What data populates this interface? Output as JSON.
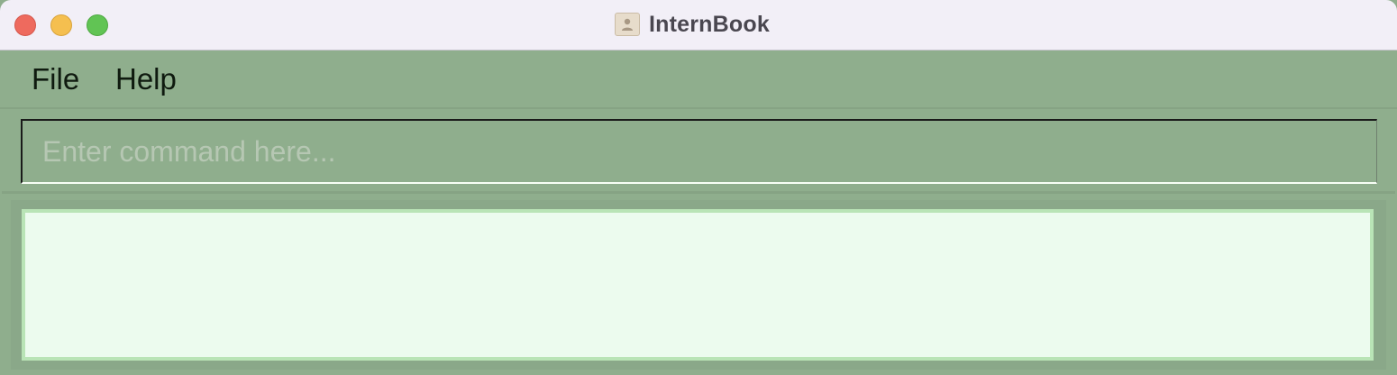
{
  "window": {
    "title": "InternBook",
    "app_icon": "contacts-book-icon"
  },
  "traffic_lights": {
    "close": "close-icon",
    "minimize": "minimize-icon",
    "zoom": "zoom-icon"
  },
  "menu": {
    "items": [
      "File",
      "Help"
    ]
  },
  "command": {
    "placeholder": "Enter command here...",
    "value": ""
  },
  "result": {
    "text": ""
  },
  "colors": {
    "titlebar_bg": "#f2eff7",
    "app_bg": "#8fae8d",
    "result_bg": "#ecfbee",
    "result_border": "#b9e4b6",
    "close": "#ee6a5e",
    "minimize": "#f5bf4f",
    "zoom": "#61c454"
  }
}
